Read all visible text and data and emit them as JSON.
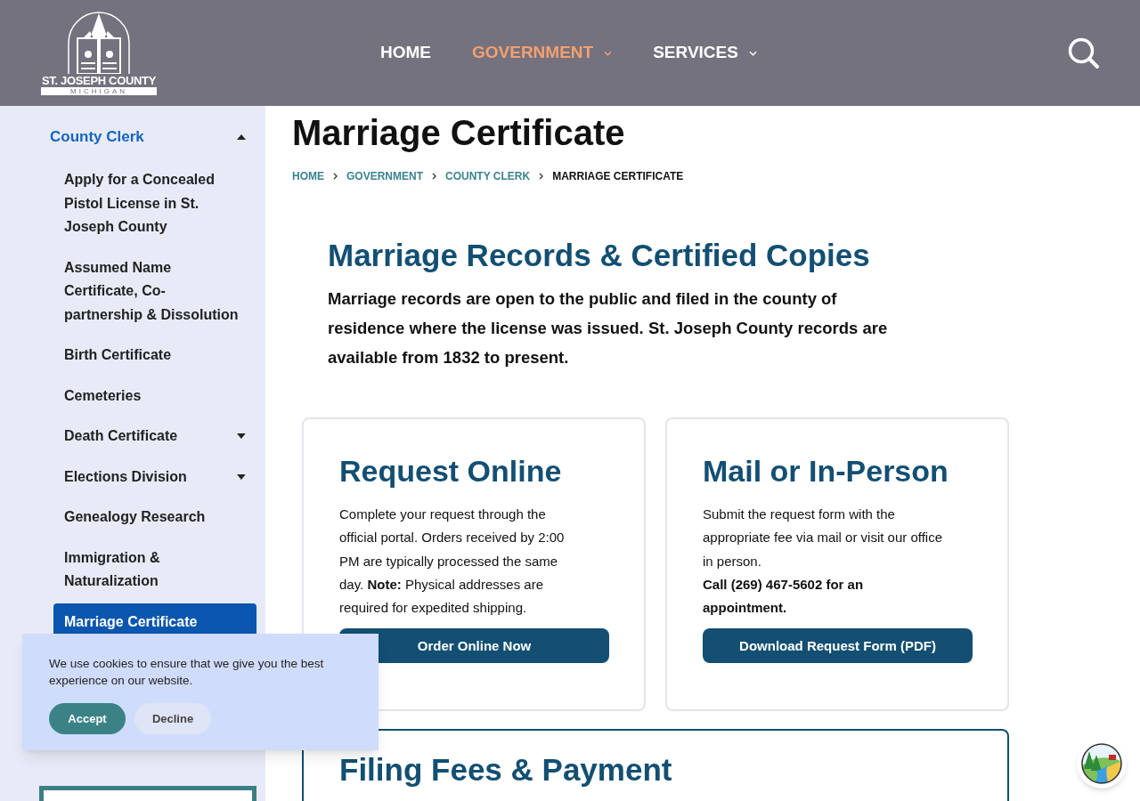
{
  "header": {
    "logo": {
      "name": "ST. JOSEPH COUNTY",
      "subtitle": "MICHIGAN"
    },
    "nav": [
      {
        "label": "HOME",
        "selected": false,
        "has_submenu": false
      },
      {
        "label": "GOVERNMENT",
        "selected": true,
        "has_submenu": true
      },
      {
        "label": "SERVICES",
        "selected": false,
        "has_submenu": true
      }
    ]
  },
  "sidebar": {
    "section": {
      "label": "County Clerk",
      "expanded": true
    },
    "items": [
      {
        "label": "Apply for a Concealed Pistol License in St. Joseph County",
        "selected": false,
        "has_submenu": false
      },
      {
        "label": "Assumed Name Certificate, Co-partnership & Dissolution",
        "selected": false,
        "has_submenu": false
      },
      {
        "label": "Birth Certificate",
        "selected": false,
        "has_submenu": false
      },
      {
        "label": "Cemeteries",
        "selected": false,
        "has_submenu": false
      },
      {
        "label": "Death Certificate",
        "selected": false,
        "has_submenu": true
      },
      {
        "label": "Elections Division",
        "selected": false,
        "has_submenu": true
      },
      {
        "label": "Genealogy Research",
        "selected": false,
        "has_submenu": false
      },
      {
        "label": "Immigration & Naturalization",
        "selected": false,
        "has_submenu": false
      },
      {
        "label": "Marriage Certificate",
        "selected": true,
        "has_submenu": false
      }
    ]
  },
  "page": {
    "title": "Marriage Certificate",
    "breadcrumb": [
      {
        "label": "HOME",
        "kind": "link"
      },
      {
        "label": "GOVERNMENT",
        "kind": "link"
      },
      {
        "label": "COUNTY CLERK",
        "kind": "link"
      },
      {
        "label": "MARRIAGE CERTIFICATE",
        "kind": "current"
      }
    ],
    "intro": {
      "heading": "Marriage Records & Certified Copies",
      "text": "Marriage records are open to the public and filed in the county of residence where the license was issued. St. Joseph County records are available from 1832 to present."
    },
    "cards": [
      {
        "heading": "Request Online",
        "paragraphs": [
          "Complete your request through the official portal. Orders received by 2:00 PM are typically processed the same day. **Note:** Physical addresses are required for expedited shipping."
        ],
        "button": "Order Online Now"
      },
      {
        "heading": "Mail or In-Person",
        "paragraphs": [
          "Submit the request form with the appropriate fee via mail or visit our office in person.",
          "**Call (269) 467-5602 for an appointment.**"
        ],
        "button": "Download Request Form (PDF)"
      }
    ],
    "fees": {
      "heading": "Filing Fees & Payment"
    }
  },
  "cookie_banner": {
    "text": "We use cookies to ensure that we give you the best experience on our website.",
    "buttons": [
      {
        "label": "Accept",
        "kind": "primary"
      },
      {
        "label": "Decline",
        "kind": "secondary"
      }
    ]
  }
}
